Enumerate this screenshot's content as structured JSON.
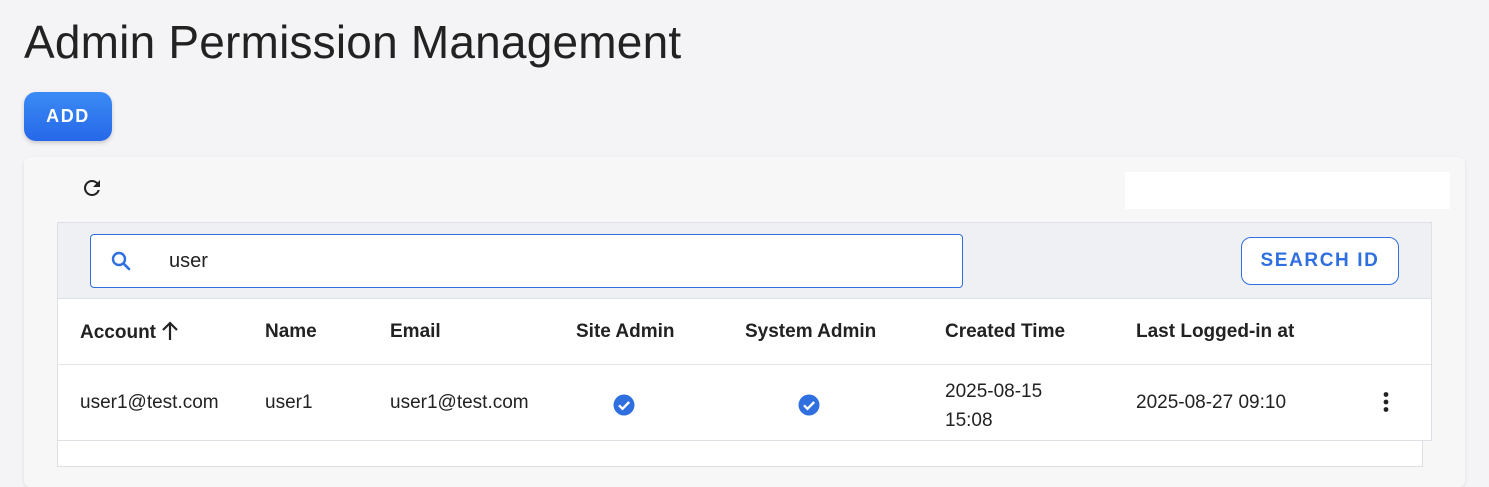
{
  "page": {
    "title": "Admin Permission Management"
  },
  "actions": {
    "add_label": "ADD"
  },
  "search": {
    "value": "user",
    "button_label": "SEARCH ID"
  },
  "table": {
    "columns": [
      "Account",
      "Name",
      "Email",
      "Site Admin",
      "System Admin",
      "Created Time",
      "Last Logged-in at"
    ],
    "sort": {
      "column": "Account",
      "direction": "ascending"
    },
    "rows": [
      {
        "account": "user1@test.com",
        "name": "user1",
        "email": "user1@test.com",
        "site_admin": true,
        "system_admin": true,
        "created_date": "2025-08-15",
        "created_time": "15:08",
        "last_logged_in": "2025-08-27 09:10"
      }
    ]
  },
  "colors": {
    "accent": "#2f6fe0",
    "check": "#2f6fe0",
    "background": "#f4f4f6"
  },
  "icons": {
    "refresh": "refresh-icon",
    "search": "search-icon",
    "sort": "arrow-up-icon",
    "check": "check-circle-icon",
    "menu": "more-vertical-icon"
  }
}
